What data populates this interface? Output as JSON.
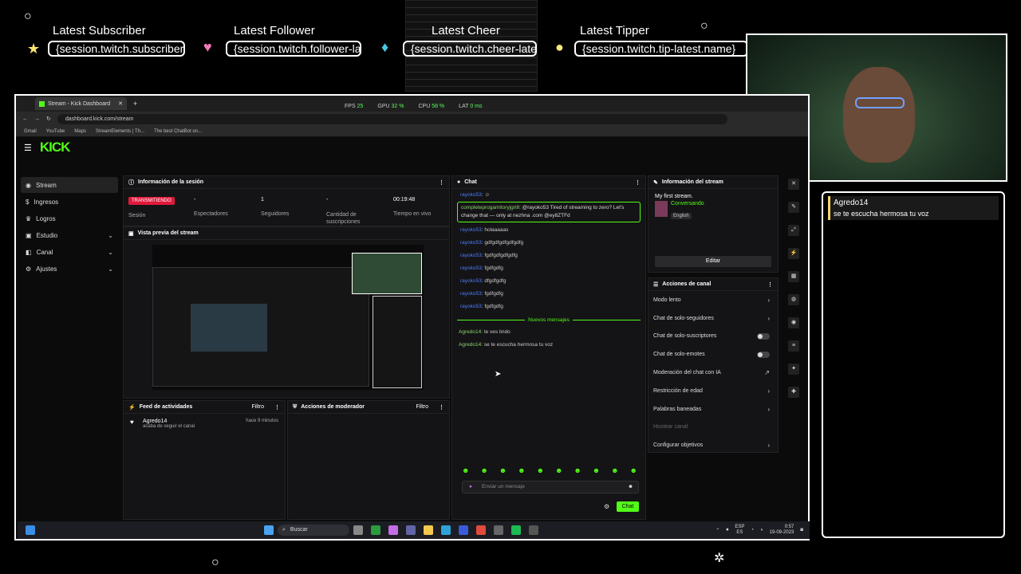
{
  "overlay": {
    "latest_subscriber_title": "Latest Subscriber",
    "latest_follower_title": "Latest Follower",
    "latest_cheer_title": "Latest Cheer",
    "latest_tipper_title": "Latest Tipper",
    "subscriber_value": "{session.twitch.subscriber-latest.name}",
    "follower_value": "{session.twitch.follower-latest.name}",
    "cheer_value": "{session.twitch.cheer-latest.name}",
    "tipper_value": "{session.twitch.tip-latest.name}"
  },
  "chat_widget": {
    "user": "Agredo14",
    "message": "se te escucha hermosa tu voz"
  },
  "browser": {
    "tab_title": "Stream - Kick Dashboard",
    "perf": {
      "fps_label": "FPS",
      "fps": "25",
      "gpu_label": "GPU",
      "gpu": "32 %",
      "cpu_label": "CPU",
      "cpu": "58 %",
      "lat_label": "LAT",
      "lat": "0 ms"
    },
    "url": "dashboard.kick.com/stream",
    "bookmarks": [
      "Gmail",
      "YouTube",
      "Maps",
      "StreamElements | Th...",
      "The best ChatBot on..."
    ]
  },
  "kick": {
    "logo": "KICK",
    "sidebar": [
      {
        "label": "Stream",
        "active": true,
        "chevron": false
      },
      {
        "label": "Ingresos",
        "active": false,
        "chevron": false
      },
      {
        "label": "Logros",
        "active": false,
        "chevron": false
      },
      {
        "label": "Estudio",
        "active": false,
        "chevron": true
      },
      {
        "label": "Canal",
        "active": false,
        "chevron": true
      },
      {
        "label": "Ajustes",
        "active": false,
        "chevron": true
      }
    ],
    "session": {
      "title": "Información de la sesión",
      "live_badge": "TRANSMITIENDO",
      "stats": [
        {
          "value": "-",
          "label": "Sesión"
        },
        {
          "value": "-",
          "label": "Espectadores"
        },
        {
          "value": "1",
          "label": "Seguidores"
        },
        {
          "value": "-",
          "label": "Cantidad de suscripciones"
        },
        {
          "value": "00:19:48",
          "label": "Tiempo en vivo"
        }
      ]
    },
    "preview": {
      "title": "Vista previa del stream"
    },
    "activity": {
      "title": "Feed de actividades",
      "filter": "Filtro",
      "user": "Agredo14",
      "text": "acaba de seguir el canal",
      "time": "hace 9 minutos"
    },
    "mod": {
      "title": "Acciones de moderador",
      "filter": "Filtro"
    },
    "chat": {
      "title": "Chat",
      "pinned_user": "completeprogamitoryjgri8",
      "pinned_text": ": @rayoko53 Tired of streaming to zero? Let's change that — only at nezhna .com @ey8ZTFd",
      "messages": [
        {
          "user": "rayoko53",
          "text": ": holaaaaas"
        },
        {
          "user": "rayoko53",
          "text": ": gdfgdfgdfgdfgdfg"
        },
        {
          "user": "rayoko53",
          "text": ": fgdfgdfgdfgdfg"
        },
        {
          "user": "rayoko53",
          "text": ": fgdfgdfg"
        },
        {
          "user": "rayoko53",
          "text": ": dfgdfgdfg"
        },
        {
          "user": "rayoko53",
          "text": ": fgdfgdfg"
        },
        {
          "user": "rayoko53",
          "text": ": fgdfgdfg"
        }
      ],
      "first_user": "rayoko53",
      "new_messages_label": "Nuevos mensajes",
      "new_messages": [
        {
          "user": "Agredo14",
          "text": ": te ves lindo"
        },
        {
          "user": "Agredo14",
          "text": ": se te escucha hermosa tu voz"
        }
      ],
      "input_placeholder": "Enviar un mensaje",
      "send_label": "Chat"
    },
    "stream_info": {
      "title": "Información del stream",
      "stream_title": "My first stream.",
      "category": "Conversando",
      "language": "English",
      "edit_label": "Editar"
    },
    "channel_actions": {
      "title": "Acciones de canal",
      "items": [
        {
          "label": "Modo lento",
          "control": "chevron"
        },
        {
          "label": "Chat de solo-seguidores",
          "control": "chevron"
        },
        {
          "label": "Chat de solo-suscriptores",
          "control": "toggle"
        },
        {
          "label": "Chat de solo-emotes",
          "control": "toggle"
        },
        {
          "label": "Moderación del chat con IA",
          "control": "link"
        },
        {
          "label": "Restricción de edad",
          "control": "chevron"
        },
        {
          "label": "Palabras baneadas",
          "control": "chevron"
        },
        {
          "label": "Hostear canal",
          "control": "none"
        },
        {
          "label": "Configurar objetivos",
          "control": "chevron"
        }
      ]
    }
  },
  "taskbar": {
    "search_label": "Buscar",
    "lang": "ESP",
    "lang2": "ES",
    "time": "0:57",
    "date": "19-09-2023"
  }
}
